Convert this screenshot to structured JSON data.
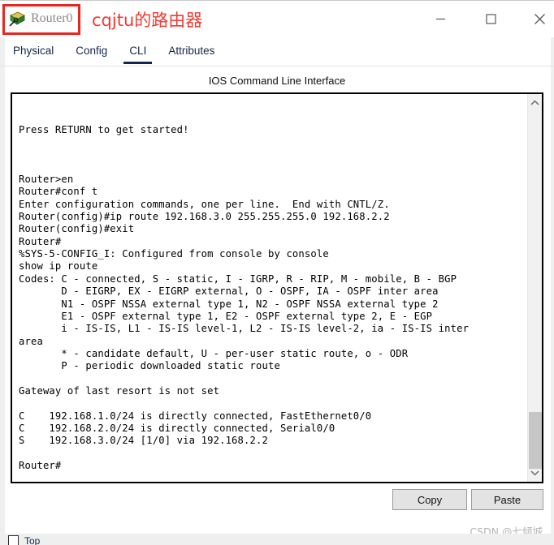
{
  "window": {
    "title": "Router0",
    "icon": "router-icon",
    "annotation_text": "cqjtu的路由器",
    "annotation_color": "#ef3b34",
    "highlight_color": "#e8251f",
    "controls": {
      "minimize": "minimize-icon",
      "maximize": "maximize-icon",
      "close": "close-icon"
    }
  },
  "tabs": [
    {
      "label": "Physical",
      "active": false
    },
    {
      "label": "Config",
      "active": false
    },
    {
      "label": "CLI",
      "active": true
    },
    {
      "label": "Attributes",
      "active": false
    }
  ],
  "cli": {
    "heading": "IOS Command Line Interface",
    "terminal_text": "\n\nPress RETURN to get started!\n\n\n\nRouter>en\nRouter#conf t\nEnter configuration commands, one per line.  End with CNTL/Z.\nRouter(config)#ip route 192.168.3.0 255.255.255.0 192.168.2.2\nRouter(config)#exit\nRouter#\n%SYS-5-CONFIG_I: Configured from console by console\nshow ip route\nCodes: C - connected, S - static, I - IGRP, R - RIP, M - mobile, B - BGP\n       D - EIGRP, EX - EIGRP external, O - OSPF, IA - OSPF inter area\n       N1 - OSPF NSSA external type 1, N2 - OSPF NSSA external type 2\n       E1 - OSPF external type 1, E2 - OSPF external type 2, E - EGP\n       i - IS-IS, L1 - IS-IS level-1, L2 - IS-IS level-2, ia - IS-IS inter\narea\n       * - candidate default, U - per-user static route, o - ODR\n       P - periodic downloaded static route\n\nGateway of last resort is not set\n\nC    192.168.1.0/24 is directly connected, FastEthernet0/0\nC    192.168.2.0/24 is directly connected, Serial0/0\nS    192.168.3.0/24 [1/0] via 192.168.2.2\n\nRouter#",
    "scrollbar": {
      "up_arrow": "chevron-up-icon",
      "down_arrow": "chevron-down-icon"
    }
  },
  "buttons": {
    "copy": "Copy",
    "paste": "Paste"
  },
  "watermark": "CSDN @七倾城",
  "bottom_row": {
    "checkbox_label": "Top",
    "checked": false
  }
}
